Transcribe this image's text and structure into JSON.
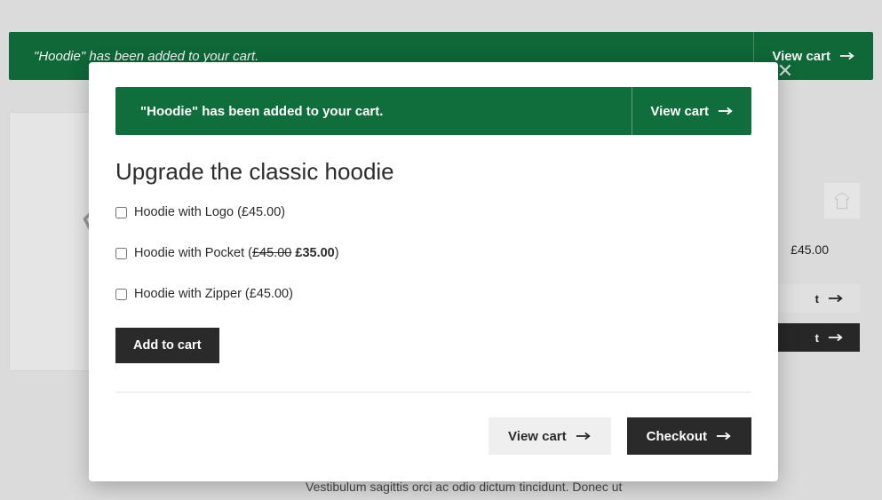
{
  "page_notice": {
    "message_prefix": "\"Hoodie\"",
    "message": " has been added to your cart.",
    "view_cart": "View cart"
  },
  "side": {
    "price": "£45.00",
    "btn1_suffix": "t",
    "btn2_suffix": "t"
  },
  "blurb": "Vestibulum sagittis orci ac odio dictum tincidunt. Donec ut",
  "modal": {
    "notice_message": "\"Hoodie\" has been added to your cart.",
    "view_cart": "View cart",
    "title": "Upgrade the classic hoodie",
    "options": [
      {
        "label": "Hoodie with Logo",
        "price": "£45.00",
        "sale": null
      },
      {
        "label": "Hoodie with Pocket",
        "price": "£45.00",
        "sale": "£35.00"
      },
      {
        "label": "Hoodie with Zipper",
        "price": "£45.00",
        "sale": null
      }
    ],
    "add_to_cart": "Add to cart",
    "actions": {
      "view_cart": "View cart",
      "checkout": "Checkout"
    }
  }
}
